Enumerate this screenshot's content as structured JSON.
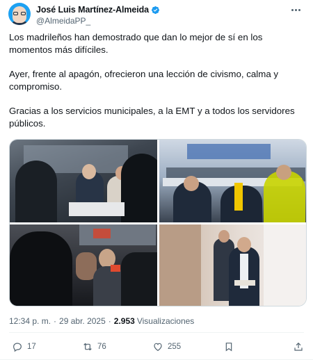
{
  "author": {
    "display_name": "José Luis Martínez-Almeida",
    "handle": "@AlmeidaPP_",
    "verified_icon": "verified-badge-icon"
  },
  "tweet": {
    "paragraphs": [
      "Los madrileños han demostrado que dan lo mejor de sí en los momentos más difíciles.",
      "Ayer, frente al apagón, ofrecieron una lección de civismo, calma y compromiso.",
      "Gracias a los servicios municipales, a la EMT y a todos los servidores públicos."
    ]
  },
  "media": {
    "photos": [
      "photo-control-room",
      "photo-meeting-table",
      "photo-press-crowd",
      "photo-walking-corridor"
    ]
  },
  "meta": {
    "time": "12:34 p. m.",
    "date": "29 abr. 2025",
    "views_count": "2.953",
    "views_label": "Visualizaciones"
  },
  "actions": {
    "replies": "17",
    "reposts": "76",
    "likes": "255"
  },
  "colors": {
    "text": "#0f1419",
    "secondary": "#536471",
    "verified": "#1d9bf0",
    "border": "#cfd9de"
  }
}
